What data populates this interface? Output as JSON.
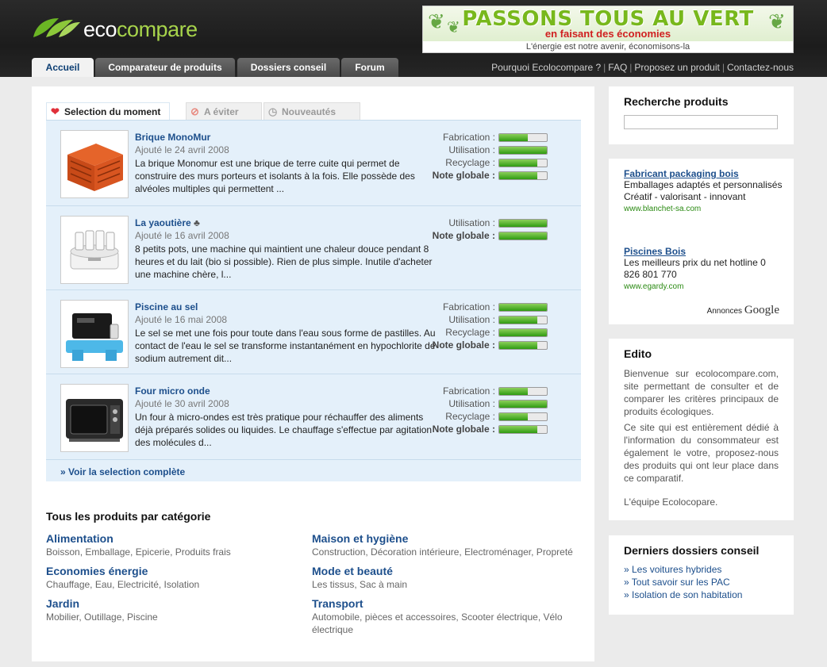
{
  "header": {
    "logo_part1": "eco",
    "logo_part2": "compare",
    "banner_line1": "PASSONS TOUS AU VERT",
    "banner_line2": "en faisant des économies",
    "banner_line3": "L'énergie est notre avenir, économisons-la"
  },
  "nav": {
    "tabs": [
      {
        "label": "Accueil"
      },
      {
        "label": "Comparateur de produits"
      },
      {
        "label": "Dossiers conseil"
      },
      {
        "label": "Forum"
      }
    ],
    "links": [
      {
        "label": "Pourquoi Ecolocompare ?"
      },
      {
        "label": "FAQ"
      },
      {
        "label": "Proposez un produit"
      },
      {
        "label": "Contactez-nous"
      }
    ]
  },
  "selection": {
    "tabs": [
      {
        "label": "Selection du moment",
        "icon": "heart-icon"
      },
      {
        "label": "A éviter",
        "icon": "forbidden-icon"
      },
      {
        "label": "Nouveautés",
        "icon": "clock-icon"
      }
    ],
    "products": [
      {
        "title": "Brique MonoMur",
        "date": "Ajouté le 24 avril 2008",
        "desc": "La brique Monomur est une brique de terre cuite qui permet de construire des murs porteurs et isolants à la fois. Elle possède des alvéoles multiples qui permettent ...",
        "image": "brick",
        "ratings": [
          {
            "label": "Fabrication :",
            "value": 0.6
          },
          {
            "label": "Utilisation :",
            "value": 1.0
          },
          {
            "label": "Recyclage :",
            "value": 0.8
          },
          {
            "label": "Note globale :",
            "value": 0.8,
            "bold": true
          }
        ]
      },
      {
        "title": "La yaoutière",
        "date": "Ajouté le 16 avril 2008",
        "desc": "8 petits pots, une machine qui maintient une chaleur douce pendant 8 heures et du lait (bio si possible). Rien de plus simple. Inutile d'acheter une machine chère, l...",
        "image": "yogurt-maker",
        "title_icon": "tree-icon",
        "ratings": [
          {
            "label": "Utilisation :",
            "value": 1.0
          },
          {
            "label": "Note globale :",
            "value": 1.0,
            "bold": true
          }
        ]
      },
      {
        "title": "Piscine au sel",
        "date": "Ajouté le 16 mai 2008",
        "desc": "Le sel se met une fois pour toute dans l'eau sous forme de pastilles. Au contact de l'eau le sel se transforme instantanément en hypochlorite de sodium autrement dit...",
        "image": "salt-chlorinator",
        "ratings": [
          {
            "label": "Fabrication :",
            "value": 1.0
          },
          {
            "label": "Utilisation :",
            "value": 0.8
          },
          {
            "label": "Recyclage :",
            "value": 1.0
          },
          {
            "label": "Note globale :",
            "value": 0.8,
            "bold": true
          }
        ]
      },
      {
        "title": "Four micro onde",
        "date": "Ajouté le 30 avril 2008",
        "desc": "Un four à micro-ondes est très pratique pour réchauffer des aliments déjà préparés solides ou liquides. Le chauffage s'effectue par agitation des molécules d...",
        "image": "microwave",
        "ratings": [
          {
            "label": "Fabrication :",
            "value": 0.6
          },
          {
            "label": "Utilisation :",
            "value": 1.0
          },
          {
            "label": "Recyclage :",
            "value": 0.6
          },
          {
            "label": "Note globale :",
            "value": 0.8,
            "bold": true
          }
        ]
      }
    ],
    "see_all": "» Voir la selection complète"
  },
  "categories": {
    "title": "Tous les produits par catégorie",
    "left": [
      {
        "name": "Alimentation",
        "items": "Boisson, Emballage, Epicerie, Produits frais"
      },
      {
        "name": "Economies énergie",
        "items": "Chauffage, Eau, Electricité, Isolation"
      },
      {
        "name": "Jardin",
        "items": "Mobilier, Outillage, Piscine"
      }
    ],
    "right": [
      {
        "name": "Maison et hygiène",
        "items": "Construction, Décoration intérieure, Electroménager, Propreté"
      },
      {
        "name": "Mode et beauté",
        "items": "Les tissus, Sac à main"
      },
      {
        "name": "Transport",
        "items": "Automobile, pièces et accessoires, Scooter électrique, Vélo électrique"
      }
    ]
  },
  "sidebar": {
    "search_title": "Recherche produits",
    "search_value": "",
    "ads": [
      {
        "title": "Fabricant packaging bois",
        "desc": "Emballages adaptés et personnalisés Créatif - valorisant - innovant",
        "url": "www.blanchet-sa.com"
      },
      {
        "title": "Piscines Bois",
        "desc": "Les meilleurs prix du net hotline 0 826 801 770",
        "url": "www.egardy.com"
      }
    ],
    "ads_label": "Annonces",
    "ads_brand": "Google",
    "edito_title": "Edito",
    "edito_p1": "Bienvenue sur ecolocompare.com, site permettant de consulter et de comparer les critères principaux de produits écologiques.",
    "edito_p2": "Ce site qui est entièrement dédié à l'information du consommateur est également le votre, proposez-nous des produits qui ont leur place dans ce comparatif.",
    "edito_p3": "L'équipe Ecolocopare.",
    "dossiers_title": "Derniers dossiers conseil",
    "dossiers": [
      {
        "label": "» Les voitures hybrides"
      },
      {
        "label": "» Tout savoir sur les PAC"
      },
      {
        "label": "» Isolation de son habitation"
      }
    ]
  }
}
